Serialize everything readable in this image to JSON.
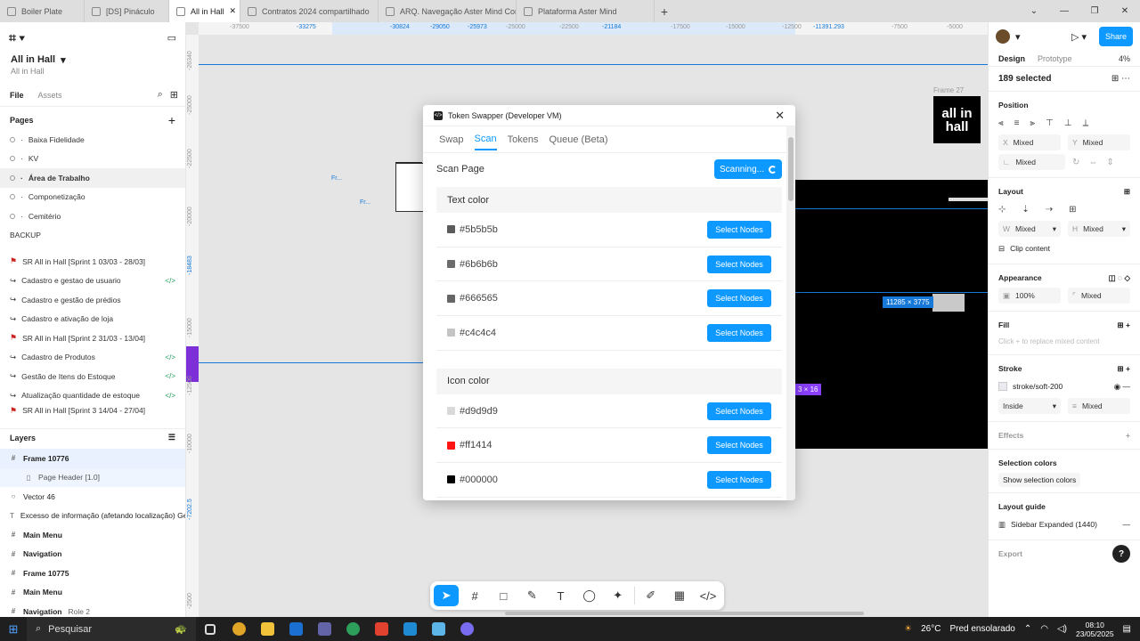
{
  "browser": {
    "tabs": [
      {
        "label": "Boiler Plate"
      },
      {
        "label": "[DS] Pináculo"
      },
      {
        "label": "All in Hall",
        "active": true
      },
      {
        "label": "Contratos 2024 compartilhado"
      },
      {
        "label": "ARQ. Navegação Aster Mind Comercial"
      },
      {
        "label": "Plataforma Aster Mind"
      }
    ],
    "new_tab": "+",
    "controls": [
      "⌄",
      "—",
      "❐",
      "✕"
    ]
  },
  "left_panel": {
    "file_name": "All in Hall",
    "file_sub": "All in Hall",
    "tabs": {
      "file": "File",
      "assets": "Assets"
    },
    "pages_title": "Pages",
    "pages": [
      {
        "label": "Baixa Fidelidade"
      },
      {
        "label": "KV"
      },
      {
        "label": "Área de Trabalho",
        "selected": true
      },
      {
        "label": "Componetização"
      },
      {
        "label": "Cemitério"
      }
    ],
    "backup_label": "BACKUP",
    "sprint_items": [
      {
        "label": "SR All in Hall [Sprint 1 03/03 - 28/03]",
        "kind": "flag"
      },
      {
        "label": "Cadastro e gestao de usuario",
        "kind": "arrow",
        "code": true
      },
      {
        "label": "Cadastro e gestão de prédios",
        "kind": "arrow"
      },
      {
        "label": "Cadastro e ativação de loja",
        "kind": "arrow"
      },
      {
        "label": "SR All in Hall [Sprint 2 31/03 - 13/04]",
        "kind": "flag"
      },
      {
        "label": "Cadastro de Produtos",
        "kind": "arrow",
        "code": true
      },
      {
        "label": "Gestão de Itens do Estoque",
        "kind": "arrow",
        "code": true
      },
      {
        "label": "Atualização quantidade de estoque",
        "kind": "arrow",
        "code": true
      },
      {
        "label": "SR All in Hall [Sprint 3 14/04 - 27/04]",
        "kind": "flag"
      }
    ],
    "layers_title": "Layers",
    "layers": [
      {
        "label": "Frame 10776",
        "bold": true,
        "selected": true,
        "icon": "#"
      },
      {
        "label": "Page Header [1.0]",
        "child": true,
        "icon": "▯"
      },
      {
        "label": "Vector 46",
        "icon": "○"
      },
      {
        "label": "Excesso de informação (afetando localização) Geral",
        "icon": "T"
      },
      {
        "label": "Main Menu",
        "bold": true,
        "icon": "#"
      },
      {
        "label": "Navigation",
        "bold": true,
        "icon": "#"
      },
      {
        "label": "Frame 10775",
        "bold": true,
        "icon": "#"
      },
      {
        "label": "Main Menu",
        "bold": true,
        "icon": "#"
      },
      {
        "label": "Navigation",
        "bold": true,
        "icon": "#",
        "extra": "Role 2"
      }
    ]
  },
  "canvas": {
    "ruler_top": [
      "-37500",
      "-33275",
      "-30824",
      "-29050",
      "-25973",
      "-25000",
      "-22500",
      "-21184",
      "-17500",
      "-15000",
      "-12500",
      "-11391.293",
      "-7500",
      "-5000"
    ],
    "ruler_left": [
      "-26340",
      "-25000",
      "-22500",
      "-20000",
      "-18483",
      "-15000",
      "-12500",
      "-10000",
      "-7202.5",
      "-2500"
    ],
    "frame_label": "Frame 27",
    "logo_text": "all in hall",
    "size_badge": "11285 × 3775",
    "purple_badge": "3 × 16",
    "mini_labels": [
      "Fr...",
      "Fr..."
    ]
  },
  "plugin": {
    "title": "Token Swapper (Developer VM)",
    "tabs": [
      {
        "label": "Swap"
      },
      {
        "label": "Scan",
        "active": true
      },
      {
        "label": "Tokens"
      },
      {
        "label": "Queue (Beta)"
      }
    ],
    "scan_title": "Scan Page",
    "scan_button": "Scanning...",
    "groups": [
      {
        "title": "Text color",
        "rows": [
          {
            "hex": "#5b5b5b",
            "color": "#5b5b5b"
          },
          {
            "hex": "#6b6b6b",
            "color": "#6b6b6b"
          },
          {
            "hex": "#666565",
            "color": "#666565"
          },
          {
            "hex": "#c4c4c4",
            "color": "#c4c4c4"
          }
        ]
      },
      {
        "title": "Icon color",
        "rows": [
          {
            "hex": "#d9d9d9",
            "color": "#d9d9d9"
          },
          {
            "hex": "#ff1414",
            "color": "#ff1414"
          },
          {
            "hex": "#000000",
            "color": "#000000"
          }
        ]
      }
    ],
    "select_label": "Select Nodes"
  },
  "right_panel": {
    "share_label": "Share",
    "tabs": {
      "design": "Design",
      "prototype": "Prototype",
      "zoom": "4%"
    },
    "selected_count": "189 selected",
    "position": {
      "title": "Position",
      "x_label": "X",
      "x_value": "Mixed",
      "y_label": "Y",
      "y_value": "Mixed",
      "rot_value": "Mixed"
    },
    "layout": {
      "title": "Layout",
      "w_label": "W",
      "w_value": "Mixed",
      "h_label": "H",
      "h_value": "Mixed",
      "clip": "Clip content"
    },
    "appearance": {
      "title": "Appearance",
      "opacity": "100%",
      "radius": "Mixed"
    },
    "fill": {
      "title": "Fill",
      "hint": "Click + to replace mixed content"
    },
    "stroke": {
      "title": "Stroke",
      "token": "stroke/soft-200",
      "position": "Inside",
      "weight": "Mixed"
    },
    "effects": {
      "title": "Effects"
    },
    "selection_colors": {
      "title": "Selection colors",
      "button": "Show selection colors"
    },
    "layout_guide": {
      "title": "Layout guide",
      "value": "Sidebar Expanded (1440)"
    },
    "export": {
      "title": "Export"
    }
  },
  "toolbar": {
    "help": "?"
  },
  "taskbar": {
    "search": "Pesquisar",
    "weather_temp": "26°C",
    "weather_text": "Pred ensolarado",
    "time": "08:10",
    "date": "23/05/2025"
  }
}
